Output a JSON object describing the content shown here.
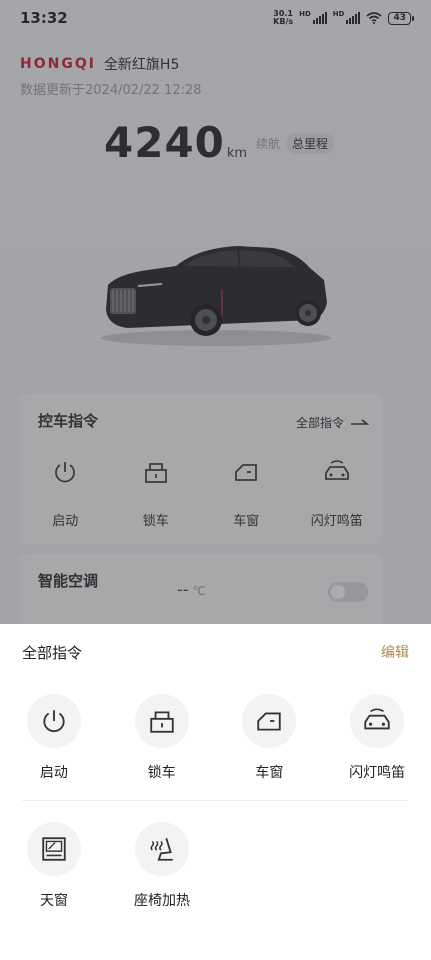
{
  "status_bar": {
    "time": "13:32",
    "net_speed_value": "30.1",
    "net_speed_unit": "KB/s",
    "hd1": "HD",
    "hd2": "HD",
    "battery": "43"
  },
  "header": {
    "brand": "HONGQI",
    "model": "全新红旗H5",
    "update_time": "数据更新于2024/02/22 12:28"
  },
  "mileage": {
    "value": "4240",
    "unit": "km",
    "tab_range": "续航",
    "tab_total": "总里程"
  },
  "control_card": {
    "title": "控车指令",
    "link": "全部指令",
    "items": [
      {
        "label": "启动",
        "icon": "power-icon"
      },
      {
        "label": "锁车",
        "icon": "lock-icon"
      },
      {
        "label": "车窗",
        "icon": "window-icon"
      },
      {
        "label": "闪灯鸣笛",
        "icon": "car-horn-icon"
      }
    ]
  },
  "ac_card": {
    "title": "智能空调",
    "temp": "--",
    "temp_unit": "℃"
  },
  "sheet": {
    "title": "全部指令",
    "edit": "编辑",
    "items_row1": [
      {
        "label": "启动",
        "icon": "power-icon"
      },
      {
        "label": "锁车",
        "icon": "lock-icon"
      },
      {
        "label": "车窗",
        "icon": "window-icon"
      },
      {
        "label": "闪灯鸣笛",
        "icon": "car-horn-icon"
      }
    ],
    "items_row2": [
      {
        "label": "天窗",
        "icon": "sunroof-icon"
      },
      {
        "label": "座椅加热",
        "icon": "seat-heat-icon"
      }
    ]
  },
  "colors": {
    "brand_red": "#c8102e",
    "edit_gold": "#b08a4a"
  }
}
